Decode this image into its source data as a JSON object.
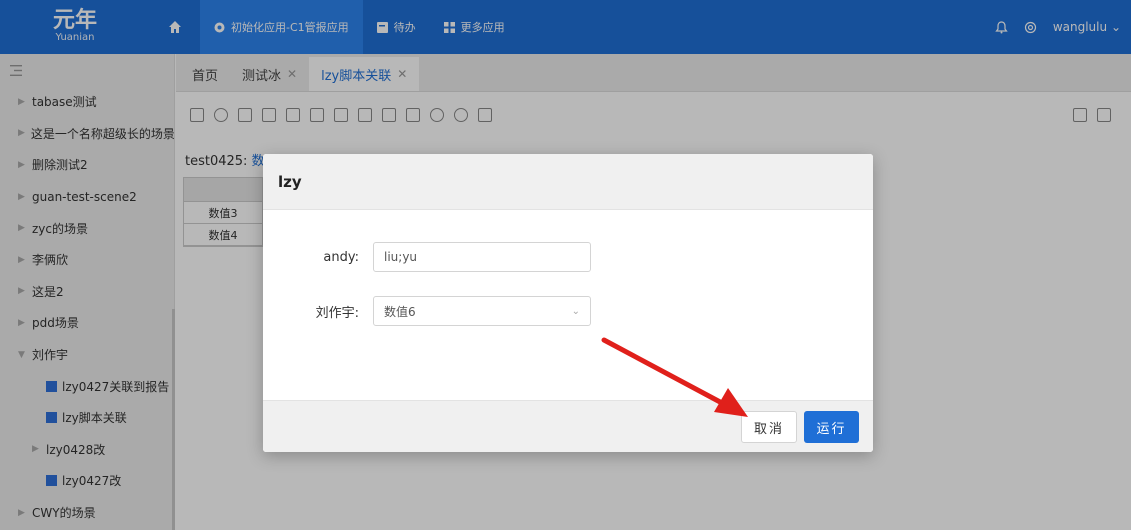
{
  "header": {
    "logo_cn": "元年",
    "logo_en": "Yuanian",
    "nav": [
      {
        "label": "初始化应用-C1管报应用",
        "icon": "app-icon",
        "active": true
      },
      {
        "label": "待办",
        "icon": "todo-icon",
        "active": false
      },
      {
        "label": "更多应用",
        "icon": "grid-icon",
        "active": false
      }
    ],
    "user": "wanglulu"
  },
  "sidebar": {
    "items": [
      {
        "label": "tabase测试",
        "type": "folder"
      },
      {
        "label": "这是一个名称超级长的场景...",
        "type": "folder"
      },
      {
        "label": "删除测试2",
        "type": "folder"
      },
      {
        "label": "guan-test-scene2",
        "type": "folder"
      },
      {
        "label": "zyc的场景",
        "type": "folder"
      },
      {
        "label": "李俩欣",
        "type": "folder"
      },
      {
        "label": "这是2",
        "type": "folder"
      },
      {
        "label": "pdd场景",
        "type": "folder"
      },
      {
        "label": "刘作宇",
        "type": "folder-open"
      },
      {
        "label": "lzy0427关联到报告",
        "type": "file"
      },
      {
        "label": "lzy脚本关联",
        "type": "file"
      },
      {
        "label": "lzy0428改",
        "type": "subfolder"
      },
      {
        "label": "lzy0427改",
        "type": "file"
      },
      {
        "label": "CWY的场景",
        "type": "folder"
      }
    ]
  },
  "tabs": [
    {
      "label": "首页",
      "closable": false,
      "active": false
    },
    {
      "label": "测试冰",
      "closable": true,
      "active": false
    },
    {
      "label": "lzy脚本关联",
      "closable": true,
      "active": true
    }
  ],
  "main": {
    "title_prefix": "test0425:",
    "title_link": "数",
    "table_rows": [
      "数值3",
      "数值4"
    ]
  },
  "modal": {
    "title": "lzy",
    "fields": [
      {
        "label": "andy:",
        "value": "liu;yu",
        "kind": "input"
      },
      {
        "label": "刘作宇:",
        "value": "数值6",
        "kind": "select"
      }
    ],
    "cancel_label": "取消",
    "run_label": "运行"
  },
  "colors": {
    "brand": "#1f6fd6",
    "annotation": "#e0201b"
  }
}
